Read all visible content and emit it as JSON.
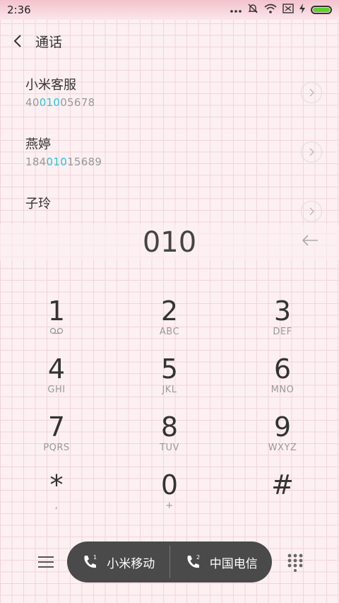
{
  "status": {
    "time": "2:36"
  },
  "header": {
    "title": "通话"
  },
  "contacts": [
    {
      "name": "小米客服",
      "num_pre": "40",
      "num_match": "010",
      "num_post": "05678"
    },
    {
      "name": "燕婷",
      "num_pre": "184",
      "num_match": "010",
      "num_post": "15689"
    },
    {
      "name": "子玲",
      "num_pre": "",
      "num_match": "",
      "num_post": ""
    }
  ],
  "dial": {
    "number": "010"
  },
  "keys": [
    {
      "digit": "1",
      "letters": ""
    },
    {
      "digit": "2",
      "letters": "ABC"
    },
    {
      "digit": "3",
      "letters": "DEF"
    },
    {
      "digit": "4",
      "letters": "GHI"
    },
    {
      "digit": "5",
      "letters": "JKL"
    },
    {
      "digit": "6",
      "letters": "MNO"
    },
    {
      "digit": "7",
      "letters": "PQRS"
    },
    {
      "digit": "8",
      "letters": "TUV"
    },
    {
      "digit": "9",
      "letters": "WXYZ"
    },
    {
      "digit": "*",
      "letters": ","
    },
    {
      "digit": "0",
      "letters": "+"
    },
    {
      "digit": "#",
      "letters": ""
    }
  ],
  "calls": {
    "sim1_label": "小米移动",
    "sim2_label": "中国电信"
  },
  "colors": {
    "highlight": "#2ec4d0",
    "battery": "#5bd12b",
    "pill": "#4a4a4a"
  }
}
